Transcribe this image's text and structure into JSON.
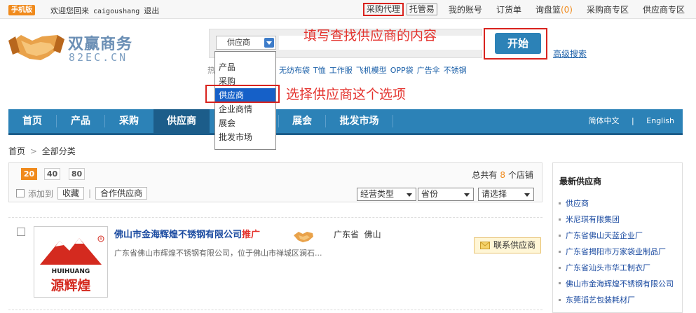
{
  "topbar": {
    "mobile": "手机版",
    "welcome": "欢迎您回来",
    "user": "caigoushang",
    "logout": "退出",
    "links": [
      "采购代理",
      "托管易",
      "我的账号",
      "订货单",
      "询盘篮",
      "采购商专区",
      "供应商专区"
    ],
    "inquiry_count": "(0)"
  },
  "logo": {
    "name": "双赢商务",
    "domain": "82EC.CN"
  },
  "search": {
    "selected": "供应商",
    "placeholder": "",
    "go": "开始",
    "advanced": "高级搜索",
    "hot_label": "热",
    "hot": [
      "无纺布袋",
      "T恤",
      "工作服",
      "飞机模型",
      "OPP袋",
      "广告伞",
      "不锈钢"
    ],
    "options": [
      "产品",
      "采购",
      "供应商",
      "企业商情",
      "展会",
      "批发市场"
    ]
  },
  "annotations": {
    "fill": "填写查找供应商的内容",
    "select": "选择供应商这个选项"
  },
  "nav": {
    "items": [
      "首页",
      "产品",
      "采购",
      "供应商",
      "",
      "展会",
      "批发市场"
    ],
    "lang_cn": "简体中文",
    "lang_en": "English"
  },
  "breadcrumb": {
    "home": "首页",
    "all": "全部分类"
  },
  "toolbar": {
    "pages": [
      "20",
      "40",
      "80"
    ],
    "total_prefix": "总共有",
    "total_count": "8",
    "total_suffix": "个店铺",
    "add_to": "添加到",
    "favorite": "收藏",
    "partner": "合作供应商",
    "filter_type": "经营类型",
    "filter_province": "省份",
    "filter_choose": "请选择"
  },
  "listing": {
    "name": "佛山市金海辉煌不锈钢有限公司",
    "tag": "推广",
    "province": "广东省",
    "city": "佛山",
    "desc": "广东省佛山市辉煌不锈钢有限公司，位于佛山市禅城区澜石...",
    "contact": "联系供应商",
    "logo_en": "HUIHUANG",
    "logo_cn": "源辉煌",
    "logo_r": "®"
  },
  "sidebar": {
    "title": "最新供应商",
    "items": [
      "供应商",
      "米尼琪有限集团",
      "广东省佛山天蓝企业厂",
      "广东省揭阳市万家袋业制品厂",
      "广东省汕头市华工制衣厂",
      "佛山市金海辉煌不锈钢有限公司",
      "东莞滔艺包装耗材厂"
    ]
  },
  "colors": {
    "accent": "#2c82b7",
    "annotation": "#e4332e",
    "orange": "#f08a1c"
  }
}
